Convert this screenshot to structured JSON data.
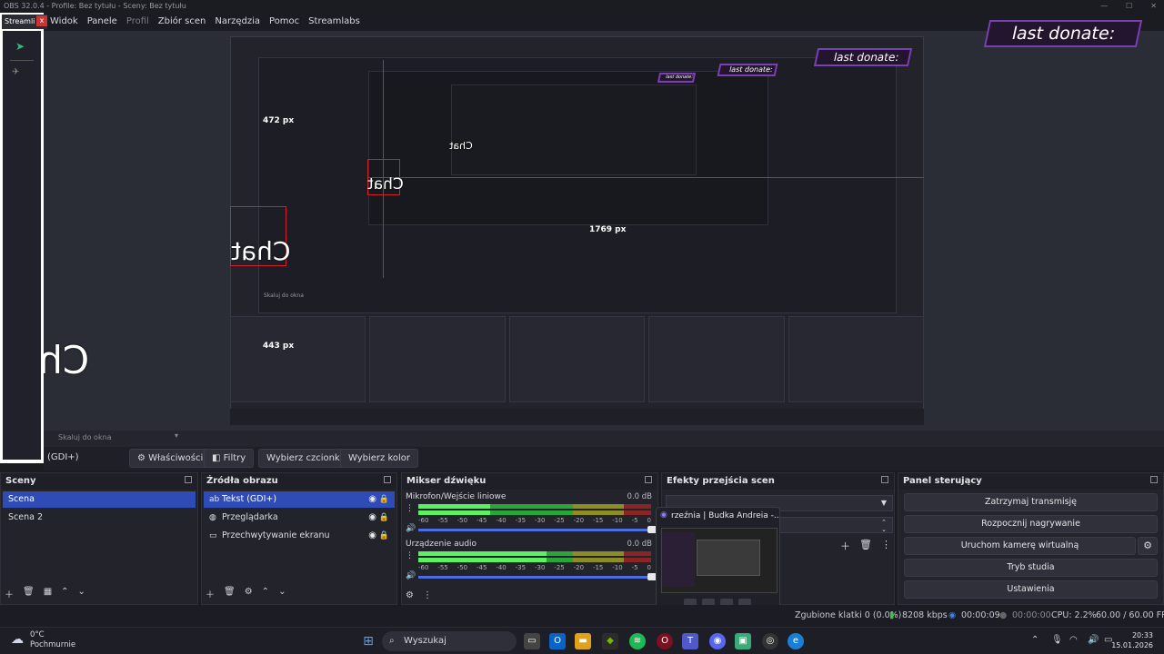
{
  "window": {
    "title": "OBS 32.0.4 - Profile: Bez tytułu - Sceny: Bez tytułu",
    "controls": [
      "—",
      "☐",
      "✕"
    ]
  },
  "menu": {
    "items": [
      "Widok",
      "Panele",
      "Profil",
      "Zbiór scen",
      "Narzędzia",
      "Pomoc",
      "Streamlabs"
    ]
  },
  "left_dock": {
    "tab_label": "Streamli",
    "close": "x"
  },
  "overlay": {
    "donate_text": "last donate:",
    "chat_text": "Chat",
    "measure_top": "472 px",
    "measure_mid": "443 px",
    "measure_width": "1769 px",
    "mini_scale": "Skaluj do okna"
  },
  "preview_footer": {
    "scale_label": "Skaluj do okna"
  },
  "source_toolbar": {
    "gdi_label": "(GDI+)",
    "properties": "Właściwości",
    "filters": "Filtry",
    "font": "Wybierz czcionkę",
    "color": "Wybierz kolor"
  },
  "scenes": {
    "title": "Sceny",
    "items": [
      {
        "label": "Scena",
        "selected": true
      },
      {
        "label": "Scena 2",
        "selected": false
      }
    ]
  },
  "sources": {
    "title": "Źródła obrazu",
    "items": [
      {
        "label": "Tekst (GDI+)",
        "icon": "text-icon",
        "selected": true
      },
      {
        "label": "Przeglądarka",
        "icon": "globe-icon",
        "selected": false
      },
      {
        "label": "Przechwytywanie ekranu",
        "icon": "monitor-icon",
        "selected": false
      }
    ]
  },
  "mixer": {
    "title": "Mikser dźwięku",
    "channels": [
      {
        "name": "Mikrofon/Wejście liniowe",
        "db": "0.0 dB",
        "level": 0.31
      },
      {
        "name": "Urządzenie audio",
        "db": "0.0 dB",
        "level": 0.55
      }
    ],
    "ticks": [
      "-60",
      "-55",
      "-50",
      "-45",
      "-40",
      "-35",
      "-30",
      "-25",
      "-20",
      "-15",
      "-10",
      "-5",
      "0"
    ]
  },
  "transitions": {
    "title": "Efekty przejścia scen",
    "popup_title": "rzeźnia | Budka Andreia -..."
  },
  "controls": {
    "title": "Panel sterujący",
    "buttons": [
      "Zatrzymaj transmisję",
      "Rozpocznij nagrywanie",
      "Uruchom kamerę wirtualną",
      "Tryb studia",
      "Ustawienia"
    ]
  },
  "status": {
    "dropped": "Zgubione klatki 0 (0.0%)",
    "bitrate": "8208 kbps",
    "stream_time": "00:00:09",
    "rec_time": "00:00:00",
    "cpu": "CPU: 2.2%",
    "fps": "60.00 / 60.00 FPS"
  },
  "taskbar": {
    "temp": "0°C",
    "weather": "Pochmurnie",
    "search": "Wyszukaj",
    "time": "20:33",
    "date": "15.01.2026"
  },
  "colors": {
    "accent": "#2f4bb5",
    "guide_red": "#d21f2c",
    "donate_border": "#7b3fb4",
    "meter_green": "#2aa53a"
  }
}
